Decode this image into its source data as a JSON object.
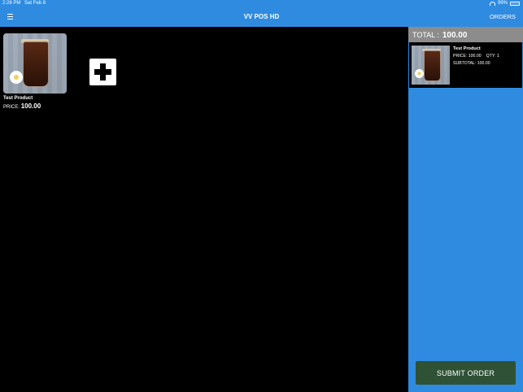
{
  "status_bar": {
    "time": "2:28 PM",
    "date": "Sat Feb 8",
    "battery": "99%",
    "battery_level": 0.99
  },
  "navbar": {
    "title": "VV POS HD",
    "orders_label": "ORDERS",
    "menu_icon": "hamburger-icon"
  },
  "products": [
    {
      "name": "Test Product",
      "price_label": "PRICE:",
      "price": "100.00"
    }
  ],
  "add_button": {
    "icon": "plus-icon"
  },
  "cart": {
    "total_label": "TOTAL :",
    "total_value": "100.00",
    "items": [
      {
        "name": "Test Product",
        "price_text": "PRICE: 100.00",
        "qty_text": "QTY: 1",
        "subtotal_text": "SUBTOTAL: 100.00"
      }
    ],
    "submit_label": "SUBMIT ORDER"
  },
  "colors": {
    "accent": "#2f8be0",
    "total_bar": "#8c8c8c",
    "submit": "#2f5136",
    "battery": "#4cd964"
  }
}
